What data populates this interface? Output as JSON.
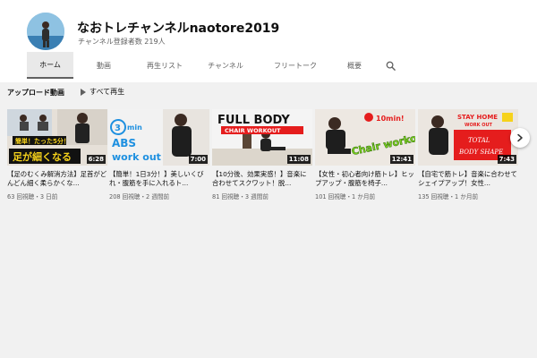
{
  "channel": {
    "name": "なおトレチャンネルnaotore2019",
    "subscribers": "チャンネル登録者数 219人"
  },
  "tabs": [
    {
      "label": "ホーム",
      "active": true
    },
    {
      "label": "動画",
      "active": false
    },
    {
      "label": "再生リスト",
      "active": false
    },
    {
      "label": "チャンネル",
      "active": false
    },
    {
      "label": "フリートーク",
      "active": false
    },
    {
      "label": "概要",
      "active": false
    }
  ],
  "search_icon": "search-icon",
  "section": {
    "title": "アップロード動画",
    "play_all_label": "すべて再生"
  },
  "videos": [
    {
      "title": "【足のむくみ解消方法】足首がどんどん細く柔らかくな...",
      "meta": "63 回視聴・3 日前",
      "duration": "6:28",
      "overlay_lines": [
        "簡単！たった5分！",
        "足が細くなる"
      ]
    },
    {
      "title": "【簡単！1日3分！】美しいくびれ・腹筋を手に入れるト...",
      "meta": "208 回視聴・2 週間前",
      "duration": "7:00",
      "overlay_lines": [
        "3",
        "min",
        "ABS",
        "work out"
      ]
    },
    {
      "title": "【10分後、効果実感！】音楽に合わせてスクワット！脱...",
      "meta": "81 回視聴・3 週間前",
      "duration": "11:08",
      "overlay_lines": [
        "FULL BODY",
        "CHAIR WORKOUT"
      ]
    },
    {
      "title": "【女性・初心者向け筋トレ】ヒップアップ・腹筋を椅子...",
      "meta": "101 回視聴・1 か月前",
      "duration": "12:41",
      "overlay_lines": [
        "10min!",
        "Chair workout"
      ]
    },
    {
      "title": "【自宅で筋トレ】音楽に合わせてシェイプアップ！女性...",
      "meta": "135 回視聴・1 か月前",
      "duration": "7:43",
      "overlay_lines": [
        "STAY HOME",
        "WORK OUT",
        "TOTAL",
        "BODY SHAPE"
      ]
    }
  ],
  "colors": {
    "accent_red": "#e51d1d",
    "yellow": "#f6d21b",
    "blue": "#1e90e0",
    "green": "#7ed321"
  }
}
